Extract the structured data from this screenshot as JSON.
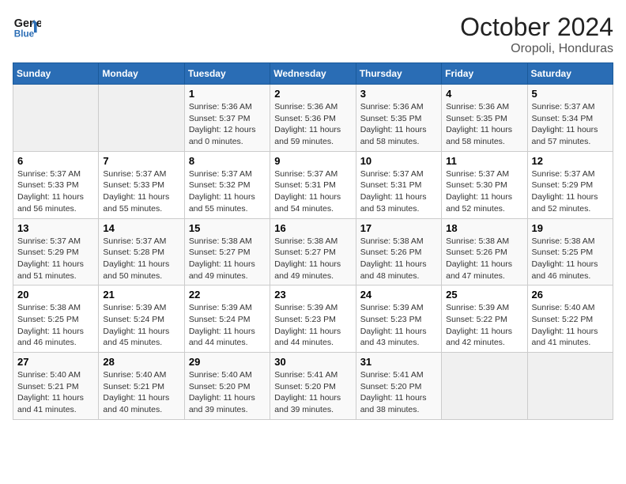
{
  "header": {
    "logo_line1": "General",
    "logo_line2": "Blue",
    "title": "October 2024",
    "subtitle": "Oropoli, Honduras"
  },
  "weekdays": [
    "Sunday",
    "Monday",
    "Tuesday",
    "Wednesday",
    "Thursday",
    "Friday",
    "Saturday"
  ],
  "weeks": [
    [
      {
        "day": "",
        "info": ""
      },
      {
        "day": "",
        "info": ""
      },
      {
        "day": "1",
        "info": "Sunrise: 5:36 AM\nSunset: 5:37 PM\nDaylight: 12 hours\nand 0 minutes."
      },
      {
        "day": "2",
        "info": "Sunrise: 5:36 AM\nSunset: 5:36 PM\nDaylight: 11 hours\nand 59 minutes."
      },
      {
        "day": "3",
        "info": "Sunrise: 5:36 AM\nSunset: 5:35 PM\nDaylight: 11 hours\nand 58 minutes."
      },
      {
        "day": "4",
        "info": "Sunrise: 5:36 AM\nSunset: 5:35 PM\nDaylight: 11 hours\nand 58 minutes."
      },
      {
        "day": "5",
        "info": "Sunrise: 5:37 AM\nSunset: 5:34 PM\nDaylight: 11 hours\nand 57 minutes."
      }
    ],
    [
      {
        "day": "6",
        "info": "Sunrise: 5:37 AM\nSunset: 5:33 PM\nDaylight: 11 hours\nand 56 minutes."
      },
      {
        "day": "7",
        "info": "Sunrise: 5:37 AM\nSunset: 5:33 PM\nDaylight: 11 hours\nand 55 minutes."
      },
      {
        "day": "8",
        "info": "Sunrise: 5:37 AM\nSunset: 5:32 PM\nDaylight: 11 hours\nand 55 minutes."
      },
      {
        "day": "9",
        "info": "Sunrise: 5:37 AM\nSunset: 5:31 PM\nDaylight: 11 hours\nand 54 minutes."
      },
      {
        "day": "10",
        "info": "Sunrise: 5:37 AM\nSunset: 5:31 PM\nDaylight: 11 hours\nand 53 minutes."
      },
      {
        "day": "11",
        "info": "Sunrise: 5:37 AM\nSunset: 5:30 PM\nDaylight: 11 hours\nand 52 minutes."
      },
      {
        "day": "12",
        "info": "Sunrise: 5:37 AM\nSunset: 5:29 PM\nDaylight: 11 hours\nand 52 minutes."
      }
    ],
    [
      {
        "day": "13",
        "info": "Sunrise: 5:37 AM\nSunset: 5:29 PM\nDaylight: 11 hours\nand 51 minutes."
      },
      {
        "day": "14",
        "info": "Sunrise: 5:37 AM\nSunset: 5:28 PM\nDaylight: 11 hours\nand 50 minutes."
      },
      {
        "day": "15",
        "info": "Sunrise: 5:38 AM\nSunset: 5:27 PM\nDaylight: 11 hours\nand 49 minutes."
      },
      {
        "day": "16",
        "info": "Sunrise: 5:38 AM\nSunset: 5:27 PM\nDaylight: 11 hours\nand 49 minutes."
      },
      {
        "day": "17",
        "info": "Sunrise: 5:38 AM\nSunset: 5:26 PM\nDaylight: 11 hours\nand 48 minutes."
      },
      {
        "day": "18",
        "info": "Sunrise: 5:38 AM\nSunset: 5:26 PM\nDaylight: 11 hours\nand 47 minutes."
      },
      {
        "day": "19",
        "info": "Sunrise: 5:38 AM\nSunset: 5:25 PM\nDaylight: 11 hours\nand 46 minutes."
      }
    ],
    [
      {
        "day": "20",
        "info": "Sunrise: 5:38 AM\nSunset: 5:25 PM\nDaylight: 11 hours\nand 46 minutes."
      },
      {
        "day": "21",
        "info": "Sunrise: 5:39 AM\nSunset: 5:24 PM\nDaylight: 11 hours\nand 45 minutes."
      },
      {
        "day": "22",
        "info": "Sunrise: 5:39 AM\nSunset: 5:24 PM\nDaylight: 11 hours\nand 44 minutes."
      },
      {
        "day": "23",
        "info": "Sunrise: 5:39 AM\nSunset: 5:23 PM\nDaylight: 11 hours\nand 44 minutes."
      },
      {
        "day": "24",
        "info": "Sunrise: 5:39 AM\nSunset: 5:23 PM\nDaylight: 11 hours\nand 43 minutes."
      },
      {
        "day": "25",
        "info": "Sunrise: 5:39 AM\nSunset: 5:22 PM\nDaylight: 11 hours\nand 42 minutes."
      },
      {
        "day": "26",
        "info": "Sunrise: 5:40 AM\nSunset: 5:22 PM\nDaylight: 11 hours\nand 41 minutes."
      }
    ],
    [
      {
        "day": "27",
        "info": "Sunrise: 5:40 AM\nSunset: 5:21 PM\nDaylight: 11 hours\nand 41 minutes."
      },
      {
        "day": "28",
        "info": "Sunrise: 5:40 AM\nSunset: 5:21 PM\nDaylight: 11 hours\nand 40 minutes."
      },
      {
        "day": "29",
        "info": "Sunrise: 5:40 AM\nSunset: 5:20 PM\nDaylight: 11 hours\nand 39 minutes."
      },
      {
        "day": "30",
        "info": "Sunrise: 5:41 AM\nSunset: 5:20 PM\nDaylight: 11 hours\nand 39 minutes."
      },
      {
        "day": "31",
        "info": "Sunrise: 5:41 AM\nSunset: 5:20 PM\nDaylight: 11 hours\nand 38 minutes."
      },
      {
        "day": "",
        "info": ""
      },
      {
        "day": "",
        "info": ""
      }
    ]
  ]
}
